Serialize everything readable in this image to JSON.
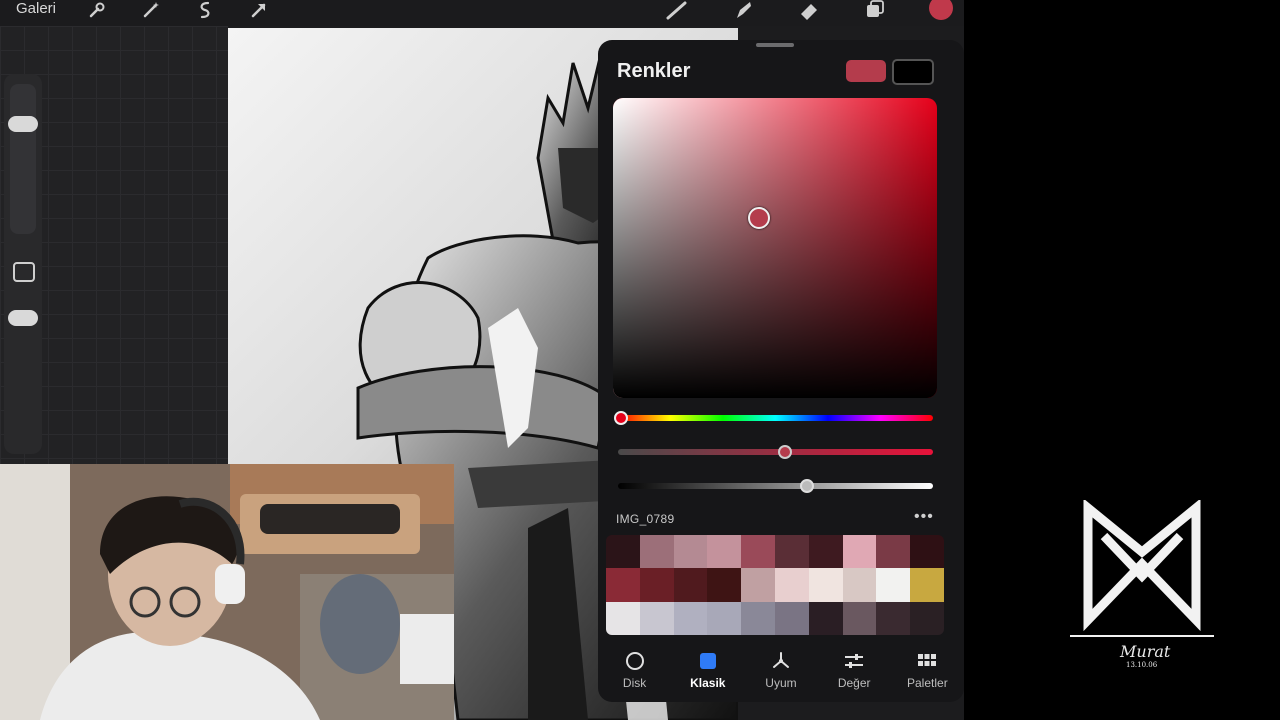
{
  "toolbar": {
    "gallery_label": "Galeri",
    "left_icons": [
      "wrench-icon",
      "magic-wand-icon",
      "selection-icon",
      "transform-arrow-icon"
    ],
    "right_icons": [
      "brush-icon",
      "smudge-icon",
      "eraser-icon",
      "layers-icon"
    ],
    "active_color": "#c0394b"
  },
  "colors_panel": {
    "title": "Renkler",
    "current_color": "#b43c4c",
    "previous_color": "#000000",
    "hue_color": "#e6001a",
    "hue_level": 0.01,
    "saturation_level": 0.53,
    "brightness_level": 0.6,
    "sv_saturation": 0.45,
    "sv_value": 0.6,
    "palette": {
      "name": "IMG_0789",
      "more_label": "•••",
      "swatches": [
        "#2b1418",
        "#9c6f79",
        "#b48a93",
        "#c4929c",
        "#9a4a59",
        "#5a2e36",
        "#3e1a20",
        "#e0a8b4",
        "#7a3a46",
        "#2e1014",
        "#8a2a36",
        "#6a1f26",
        "#501a1e",
        "#3e1414",
        "#c0a0a2",
        "#e8cfcf",
        "#f0e4e0",
        "#d8c8c4",
        "#f2f2f0",
        "#c8a840",
        "#e6e4e6",
        "#c8c6d0",
        "#b0b0c0",
        "#a8a8b8",
        "#8a8898",
        "#7a7484",
        "#2a1e24",
        "#6a5860",
        "#3a2a30",
        "#2a2024"
      ]
    },
    "tabs": [
      {
        "label": "Disk",
        "icon": "disc-icon"
      },
      {
        "label": "Klasik",
        "icon": "square-icon"
      },
      {
        "label": "Uyum",
        "icon": "harmony-icon"
      },
      {
        "label": "Değer",
        "icon": "sliders-icon"
      },
      {
        "label": "Paletler",
        "icon": "grid-icon"
      }
    ],
    "active_tab": "Klasik"
  },
  "branding": {
    "logo": "MM-monogram",
    "signature": "Murat",
    "signature_date": "13.10.06"
  }
}
